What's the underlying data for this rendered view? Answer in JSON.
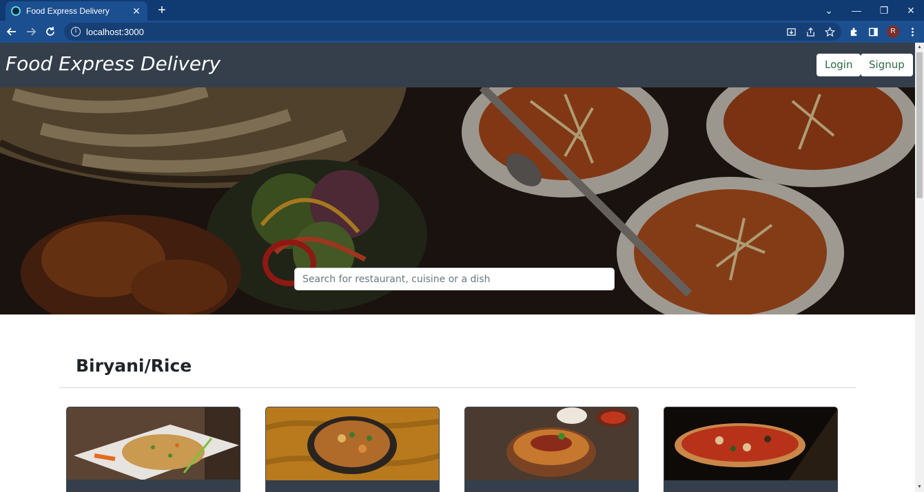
{
  "browser": {
    "tab_title": "Food Express Delivery",
    "url": "localhost:3000",
    "profile_initial": "R"
  },
  "navbar": {
    "brand": "Food Express Delivery",
    "login_label": "Login",
    "signup_label": "Signup"
  },
  "hero": {
    "search_placeholder": "Search for restaurant, cuisine or a dish"
  },
  "category": {
    "title": "Biryani/Rice",
    "items": [
      {
        "image": "fried-rice-plate-image"
      },
      {
        "image": "biryani-bowl-image"
      },
      {
        "image": "biryani-pot-image"
      },
      {
        "image": "pizza-image"
      }
    ]
  },
  "colors": {
    "tabstrip": "#0f3a72",
    "toolbar": "#1c4f8f",
    "navbar": "#343f4b",
    "button_text": "#2e6b45"
  }
}
